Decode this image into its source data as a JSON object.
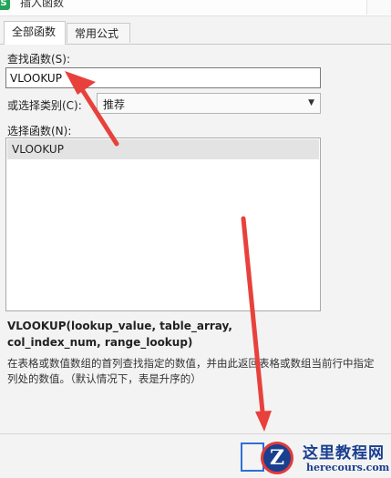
{
  "window": {
    "title": "插入函数"
  },
  "tabs": [
    {
      "label": "全部函数",
      "active": true
    },
    {
      "label": "常用公式",
      "active": false
    }
  ],
  "search": {
    "label": "查找函数(S):",
    "value": "VLOOKUP"
  },
  "category": {
    "label": "或选择类别(C):",
    "selected": "推荐"
  },
  "function_list": {
    "label": "选择函数(N):",
    "items": [
      "VLOOKUP"
    ]
  },
  "signature": "VLOOKUP(lookup_value, table_array, col_index_num, range_lookup)",
  "description": "在表格或数值数组的首列查找指定的数值，并由此返回表格或数组当前行中指定列处的数值。（默认情况下，表是升序的）",
  "watermark": {
    "title": "这里教程网",
    "subtitle": "herecours.com"
  },
  "colors": {
    "annotation_arrow": "#e8413c",
    "watermark": "#1a3f8f"
  }
}
